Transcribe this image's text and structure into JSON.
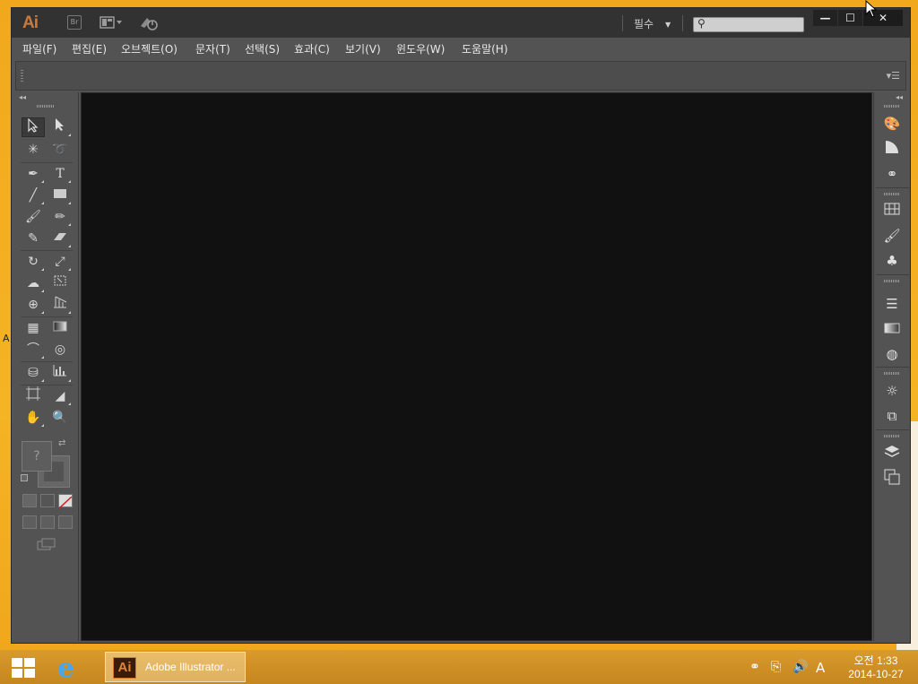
{
  "window": {
    "app_logo": "Ai",
    "bridge_label": "Br",
    "workspace_label": "필수",
    "search": {
      "value": "",
      "placeholder": ""
    },
    "controls": {
      "minimize": "—",
      "maximize": "☐",
      "close": "✕"
    }
  },
  "menu": [
    {
      "label": "파일(F)"
    },
    {
      "label": "편집(E)"
    },
    {
      "label": "오브젝트(O)"
    },
    {
      "label": "문자(T)"
    },
    {
      "label": "선택(S)"
    },
    {
      "label": "효과(C)"
    },
    {
      "label": "보기(V)"
    },
    {
      "label": "윈도우(W)"
    },
    {
      "label": "도움말(H)"
    }
  ],
  "toolbar": {
    "fill_stroke_unknown": "?",
    "tools": [
      "selection-tool",
      "direct-selection-tool",
      "magic-wand-tool",
      "lasso-tool",
      "pen-tool",
      "type-tool",
      "line-segment-tool",
      "rectangle-tool",
      "paintbrush-tool",
      "pencil-tool",
      "blob-brush-tool",
      "eraser-tool",
      "rotate-tool",
      "scale-tool",
      "warp-tool",
      "free-transform-tool",
      "shape-builder-tool",
      "perspective-grid-tool",
      "mesh-tool",
      "gradient-tool",
      "eyedropper-tool",
      "blend-tool",
      "symbol-sprayer-tool",
      "column-graph-tool",
      "artboard-tool",
      "slice-tool",
      "hand-tool",
      "zoom-tool"
    ],
    "type_tool_glyph": "T"
  },
  "right_panels": [
    "color-panel",
    "color-guide-panel",
    "symbols-panel",
    "swatches-panel",
    "brushes-panel",
    "symbols-sprayer-panel",
    "stroke-panel",
    "gradient-panel",
    "transparency-panel",
    "appearance-panel",
    "graphic-styles-panel",
    "layers-panel",
    "artboards-panel"
  ],
  "taskbar": {
    "task_icon_label": "Ai",
    "task_label": "Adobe Illustrator ...",
    "ime_indicator": "A",
    "time": "오전 1:33",
    "date": "2014-10-27"
  },
  "colors": {
    "desktop": "#f2a81c",
    "app_chrome": "#535353",
    "canvas": "#111111",
    "brand": "#c97a3a"
  }
}
